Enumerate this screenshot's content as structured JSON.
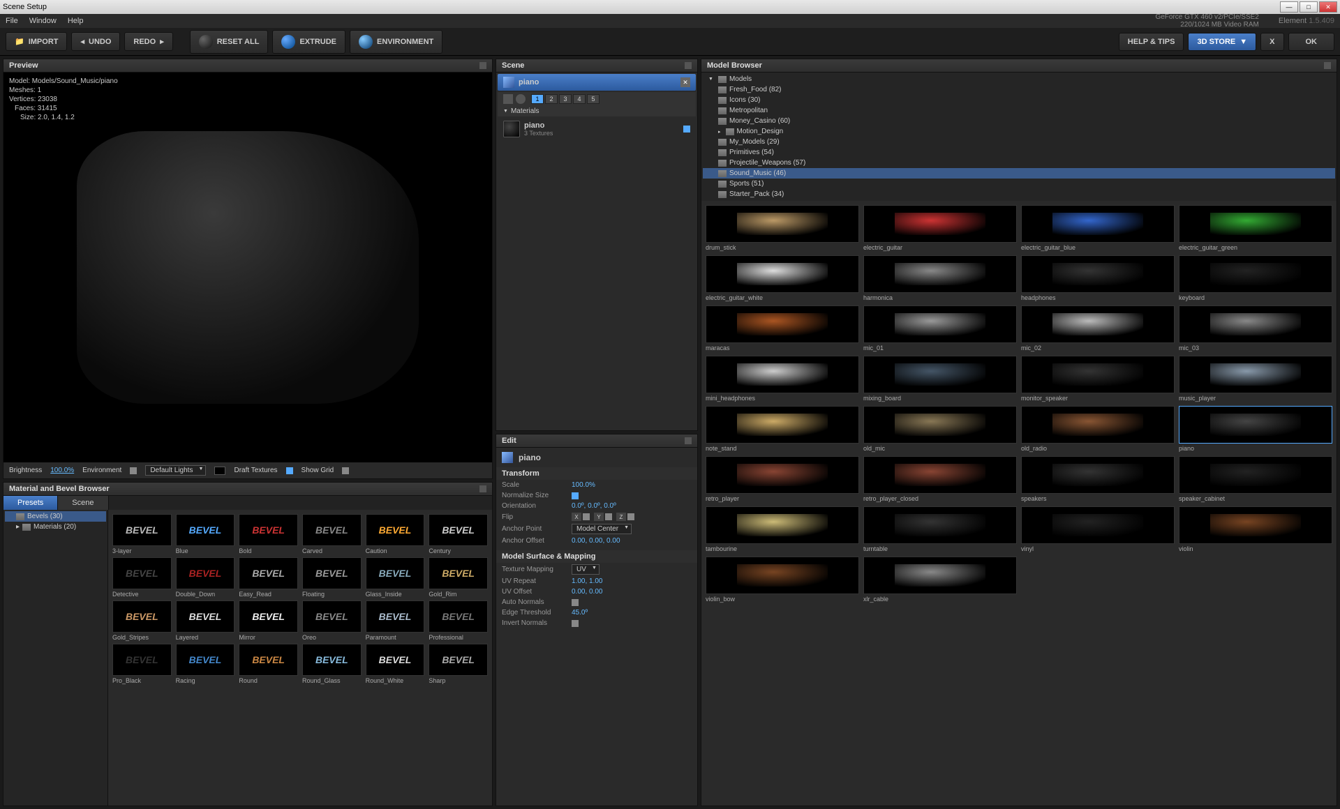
{
  "titlebar": "Scene Setup",
  "menu": {
    "file": "File",
    "window": "Window",
    "help": "Help"
  },
  "gpu": {
    "line1": "GeForce GTX 460 v2/PCIe/SSE2",
    "line2": "220/1024 MB Video RAM",
    "app": "Element",
    "ver": "1.5.409"
  },
  "toolbar": {
    "import": "IMPORT",
    "undo": "UNDO",
    "redo": "REDO",
    "resetall": "RESET ALL",
    "extrude": "EXTRUDE",
    "environment": "ENVIRONMENT",
    "help": "HELP & TIPS",
    "store": "3D STORE",
    "x": "X",
    "ok": "OK"
  },
  "preview": {
    "title": "Preview",
    "info": {
      "model": "Model: Models/Sound_Music/piano",
      "meshes": "Meshes: 1",
      "vertices": "Vertices: 23038",
      "faces": "Faces: 31415",
      "size": "Size: 2.0, 1.4, 1.2"
    },
    "controls": {
      "brightness_label": "Brightness",
      "brightness": "100.0%",
      "env_label": "Environment",
      "lights": "Default Lights",
      "draft_label": "Draft Textures",
      "grid_label": "Show Grid"
    }
  },
  "matbrowser": {
    "title": "Material and Bevel Browser",
    "tabs": {
      "presets": "Presets",
      "scene": "Scene"
    },
    "tree": {
      "bevels": "Bevels (30)",
      "materials": "Materials (20)"
    },
    "bevels": [
      {
        "n": "3-layer",
        "c": "#bbb"
      },
      {
        "n": "Blue",
        "c": "#5af"
      },
      {
        "n": "Bold",
        "c": "#c33"
      },
      {
        "n": "Carved",
        "c": "#888"
      },
      {
        "n": "Caution",
        "c": "#fa3"
      },
      {
        "n": "Century",
        "c": "#ccc"
      },
      {
        "n": "Detective",
        "c": "#444"
      },
      {
        "n": "Double_Down",
        "c": "#a22"
      },
      {
        "n": "Easy_Read",
        "c": "#aaa"
      },
      {
        "n": "Floating",
        "c": "#999"
      },
      {
        "n": "Glass_Inside",
        "c": "#8ab"
      },
      {
        "n": "Gold_Rim",
        "c": "#ca6"
      },
      {
        "n": "Gold_Stripes",
        "c": "#c96"
      },
      {
        "n": "Layered",
        "c": "#ddd"
      },
      {
        "n": "Mirror",
        "c": "#eee"
      },
      {
        "n": "Oreo",
        "c": "#888"
      },
      {
        "n": "Paramount",
        "c": "#abc"
      },
      {
        "n": "Professional",
        "c": "#777"
      },
      {
        "n": "Pro_Black",
        "c": "#333"
      },
      {
        "n": "Racing",
        "c": "#48c"
      },
      {
        "n": "Round",
        "c": "#c84"
      },
      {
        "n": "Round_Glass",
        "c": "#8bd"
      },
      {
        "n": "Round_White",
        "c": "#ddd"
      },
      {
        "n": "Sharp",
        "c": "#aaa"
      }
    ]
  },
  "scene": {
    "title": "Scene",
    "item": "piano",
    "nums": [
      "1",
      "2",
      "3",
      "4",
      "5"
    ],
    "materials": "Materials",
    "mat_name": "piano",
    "mat_sub": "3 Textures"
  },
  "edit": {
    "title": "Edit",
    "item": "piano",
    "transform": "Transform",
    "props": {
      "scale": {
        "l": "Scale",
        "v": "100.0%"
      },
      "normsize": {
        "l": "Normalize Size"
      },
      "orient": {
        "l": "Orientation",
        "v": "0.0º, 0.0º, 0.0º"
      },
      "flip": {
        "l": "Flip",
        "x": "X",
        "y": "Y",
        "z": "Z"
      },
      "anchorpt": {
        "l": "Anchor Point",
        "v": "Model Center"
      },
      "anchoroff": {
        "l": "Anchor Offset",
        "v": "0.00, 0.00, 0.00"
      }
    },
    "surface": "Model Surface & Mapping",
    "surf": {
      "texmap": {
        "l": "Texture Mapping",
        "v": "UV"
      },
      "uvrep": {
        "l": "UV Repeat",
        "v": "1.00, 1.00"
      },
      "uvoff": {
        "l": "UV Offset",
        "v": "0.00, 0.00"
      },
      "autonorm": {
        "l": "Auto Normals"
      },
      "edgeth": {
        "l": "Edge Threshold",
        "v": "45.0º"
      },
      "invnorm": {
        "l": "Invert Normals"
      }
    }
  },
  "modelbrowser": {
    "title": "Model Browser",
    "tree": [
      {
        "n": "Models",
        "d": 0,
        "exp": true
      },
      {
        "n": "Fresh_Food (82)",
        "d": 1
      },
      {
        "n": "Icons (30)",
        "d": 1
      },
      {
        "n": "Metropolitan",
        "d": 1
      },
      {
        "n": "Money_Casino (60)",
        "d": 1
      },
      {
        "n": "Motion_Design",
        "d": 1,
        "arrow": true
      },
      {
        "n": "My_Models (29)",
        "d": 1
      },
      {
        "n": "Primitives (54)",
        "d": 1
      },
      {
        "n": "Projectile_Weapons (57)",
        "d": 1
      },
      {
        "n": "Sound_Music (46)",
        "d": 1,
        "sel": true
      },
      {
        "n": "Sports (51)",
        "d": 1
      },
      {
        "n": "Starter_Pack (34)",
        "d": 1
      }
    ],
    "models": [
      "drum_stick",
      "electric_guitar",
      "electric_guitar_blue",
      "electric_guitar_green",
      "electric_guitar_white",
      "harmonica",
      "headphones",
      "keyboard",
      "maracas",
      "mic_01",
      "mic_02",
      "mic_03",
      "mini_headphones",
      "mixing_board",
      "monitor_speaker",
      "music_player",
      "note_stand",
      "old_mic",
      "old_radio",
      "piano",
      "retro_player",
      "retro_player_closed",
      "speakers",
      "speaker_cabinet",
      "tambourine",
      "turntable",
      "vinyl",
      "violin",
      "violin_bow",
      "xlr_cable"
    ],
    "model_colors": [
      "#b96",
      "#c33",
      "#36c",
      "#3a3",
      "#ddd",
      "#888",
      "#333",
      "#222",
      "#a52",
      "#999",
      "#bbb",
      "#888",
      "#ccc",
      "#456",
      "#333",
      "#89a",
      "#ca6",
      "#875",
      "#853",
      "#444",
      "#843",
      "#843",
      "#333",
      "#222",
      "#cb7",
      "#333",
      "#222",
      "#742",
      "#742",
      "#888"
    ]
  }
}
